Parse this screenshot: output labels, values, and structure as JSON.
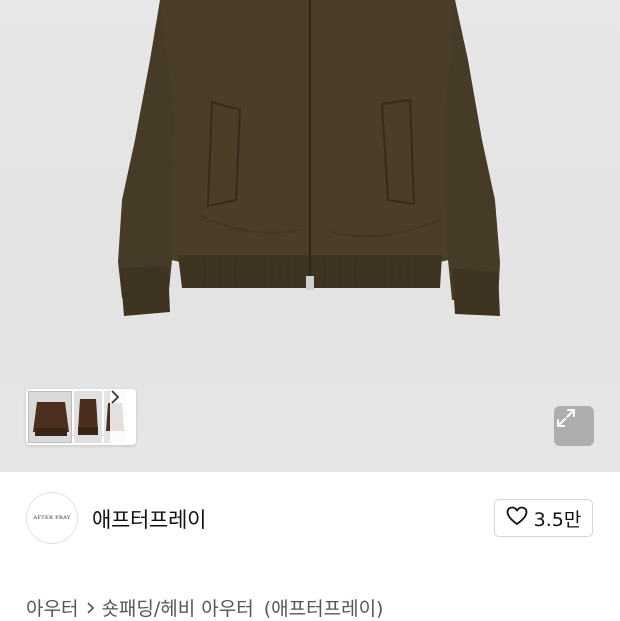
{
  "product": {
    "image_alt": "brown bomber jacket",
    "thumbnails_count": 3,
    "icons": {
      "next": "chevron-right-icon",
      "expand": "expand-icon"
    }
  },
  "brand": {
    "logo_text": "AFTER PRAY",
    "name": "애프터프레이"
  },
  "like": {
    "icon": "heart-outline-icon",
    "count": "3.5만"
  },
  "breadcrumb": {
    "category": "아우터",
    "subcategory": "숏패딩/헤비 아우터",
    "brand_tag": "(애프터프레이)"
  }
}
